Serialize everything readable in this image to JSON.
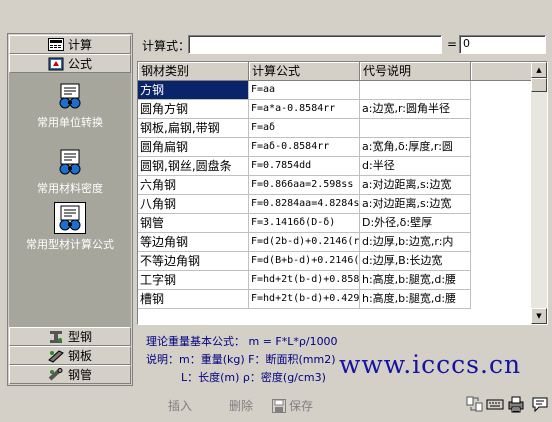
{
  "left_nav": {
    "top_tabs": [
      {
        "label": "计算",
        "icon": "calculator-icon"
      },
      {
        "label": "公式",
        "icon": "formula-book-icon"
      }
    ],
    "tools": [
      {
        "label": "常用单位转换",
        "icon": "unit-conversion-icon",
        "selected": false
      },
      {
        "label": "常用材料密度",
        "icon": "material-density-icon",
        "selected": false
      },
      {
        "label": "常用型材计算公式",
        "icon": "profile-formula-icon",
        "selected": true
      }
    ],
    "bottom_tabs": [
      {
        "label": "型钢",
        "icon": "section-steel-icon"
      },
      {
        "label": "钢板",
        "icon": "steel-plate-icon"
      },
      {
        "label": "钢管",
        "icon": "steel-pipe-icon"
      }
    ]
  },
  "formula_bar": {
    "label": "计算式：",
    "formula_value": "",
    "equals": "=",
    "result_value": "0"
  },
  "table": {
    "headers": [
      "钢材类别",
      "计算公式",
      "代号说明"
    ],
    "rows": [
      {
        "category": "方钢",
        "formula": "F=aa",
        "legend": ""
      },
      {
        "category": "圆角方钢",
        "formula": "F=a*a-0.8584rr",
        "legend": "a:边宽,r:圆角半径"
      },
      {
        "category": "钢板,扁钢,带钢",
        "formula": "F=aδ",
        "legend": ""
      },
      {
        "category": "圆角扁钢",
        "formula": "F=aδ-0.8584rr",
        "legend": "a:宽角,δ:厚度,r:圆"
      },
      {
        "category": "圆钢,钢丝,圆盘条",
        "formula": "F=0.7854dd",
        "legend": "d:半径"
      },
      {
        "category": "六角钢",
        "formula": "F=0.866aa=2.598ss",
        "legend": "a:对边距离,s:边宽"
      },
      {
        "category": "八角钢",
        "formula": "F=0.8284aa=4.8284ss",
        "legend": "a:对边距离,s:边宽"
      },
      {
        "category": "钢管",
        "formula": "F=3.1416δ(D-δ)",
        "legend": "D:外径,δ:壁厚"
      },
      {
        "category": "等边角钢",
        "formula": "F=d(2b-d)+0.2146(r",
        "legend": "d:边厚,b:边宽,r:内"
      },
      {
        "category": "不等边角钢",
        "formula": "F=d(B+b-d)+0.2146(",
        "legend": "d:边厚,B:长边宽"
      },
      {
        "category": "工字钢",
        "formula": "F=hd+2t(b-d)+0.858",
        "legend": "h:高度,b:腿宽,d:腰"
      },
      {
        "category": "槽钢",
        "formula": "F=hd+2t(b-d)+0.429",
        "legend": "h:高度,b:腿宽,d:腰"
      }
    ],
    "selected_row": 0
  },
  "notes": {
    "line1": "理论重量基本公式：  m = F*L*ρ/1000",
    "line2": "说明：m：重量(kg)   F：断面积(mm2)",
    "line3": "L：长度(m)    ρ：密度(g/cm3)"
  },
  "watermark": "www.icccs.cn",
  "toolbar": {
    "insert_label": "插入",
    "delete_label": "删除",
    "save_label": "保存"
  },
  "colors": {
    "selection": "#0a246a",
    "nav_panel": "#a6a69c",
    "notes_text": "#000080",
    "watermark": "#1414a0"
  }
}
